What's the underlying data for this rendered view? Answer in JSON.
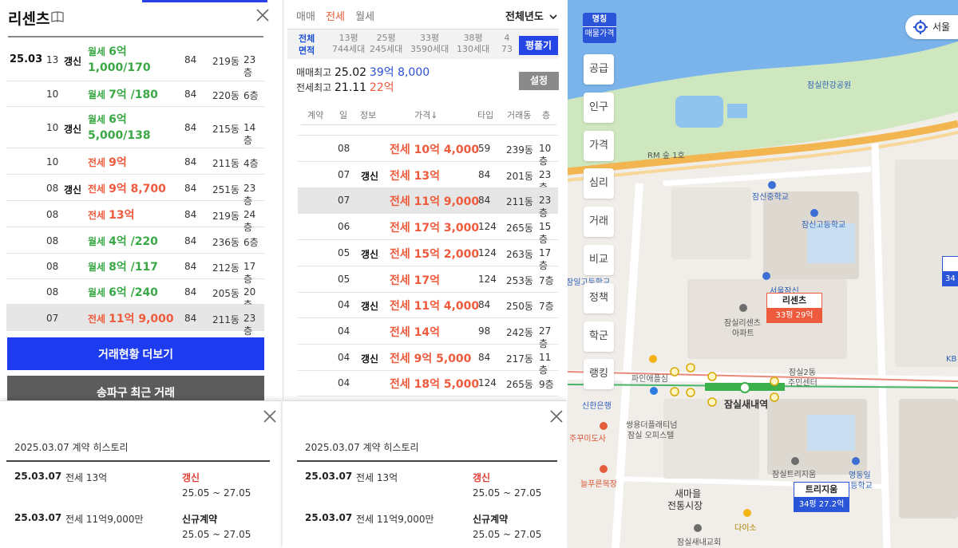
{
  "left": {
    "title": "리센츠",
    "rows": [
      {
        "ym": "25.03",
        "day": "13",
        "renew": "갱신",
        "kind": "월세",
        "price": "6억",
        "price2": "1,000/170",
        "type": "84",
        "dong": "219동",
        "floor": "23층"
      },
      {
        "ym": "",
        "day": "10",
        "renew": "",
        "kind": "월세",
        "price": "7억 /180",
        "price2": "",
        "type": "84",
        "dong": "220동",
        "floor": "6층"
      },
      {
        "ym": "",
        "day": "10",
        "renew": "갱신",
        "kind": "월세",
        "price": "6억",
        "price2": "5,000/138",
        "type": "84",
        "dong": "215동",
        "floor": "14층"
      },
      {
        "ym": "",
        "day": "10",
        "renew": "",
        "kind": "전세",
        "price": "9억",
        "price2": "",
        "type": "84",
        "dong": "211동",
        "floor": "4층"
      },
      {
        "ym": "",
        "day": "08",
        "renew": "갱신",
        "kind": "전세",
        "price": "9억 8,700",
        "price2": "",
        "type": "84",
        "dong": "251동",
        "floor": "23층"
      },
      {
        "ym": "",
        "day": "08",
        "renew": "",
        "kind": "전세",
        "price": "13억",
        "price2": "",
        "type": "84",
        "dong": "219동",
        "floor": "24층"
      },
      {
        "ym": "",
        "day": "08",
        "renew": "",
        "kind": "월세",
        "price": "4억 /220",
        "price2": "",
        "type": "84",
        "dong": "236동",
        "floor": "6층"
      },
      {
        "ym": "",
        "day": "08",
        "renew": "",
        "kind": "월세",
        "price": "8억 /117",
        "price2": "",
        "type": "84",
        "dong": "212동",
        "floor": "17층"
      },
      {
        "ym": "",
        "day": "08",
        "renew": "",
        "kind": "월세",
        "price": "6억 /240",
        "price2": "",
        "type": "84",
        "dong": "205동",
        "floor": "20층"
      },
      {
        "ym": "",
        "day": "07",
        "renew": "",
        "kind": "전세",
        "price": "11억 9,000",
        "price2": "",
        "type": "84",
        "dong": "211동",
        "floor": "23층"
      }
    ],
    "more_button": "거래현황 더보기",
    "songpa_button": "송파구 최근 거래"
  },
  "history": {
    "header": "2025.03.07 계약 히스토리",
    "items": [
      {
        "date": "25.03.07",
        "price": "전세 13억",
        "kind": "갱신",
        "period": "25.05 ~ 27.05"
      },
      {
        "date": "25.03.07",
        "price": "전세 11억9,000만",
        "kind": "신규계약",
        "period": "25.05 ~ 27.05"
      }
    ]
  },
  "mid": {
    "tabs": [
      "매매",
      "전세",
      "월세"
    ],
    "active_tab": "전세",
    "year_select": "전체년도",
    "size_label1": "전체",
    "size_label2": "면적",
    "sizes": [
      {
        "p": "13평",
        "u": "744세대"
      },
      {
        "p": "25평",
        "u": "245세대"
      },
      {
        "p": "33평",
        "u": "3590세대"
      },
      {
        "p": "38평",
        "u": "130세대"
      },
      {
        "p": "4",
        "u": "73"
      }
    ],
    "pyeong_button": "평풀기",
    "max_sale_label": "매매최고",
    "max_sale_date": "25.02",
    "max_sale_price": "39억 8,000",
    "max_jeonse_label": "전세최고",
    "max_jeonse_date": "21.11",
    "max_jeonse_price": "22억",
    "settings_button": "설정",
    "columns": [
      "계약",
      "일",
      "정보",
      "가격↓",
      "타입",
      "거래동",
      "층"
    ],
    "rows": [
      {
        "day": "08",
        "renew": "",
        "price": "전세 10억 4,000",
        "type": "59",
        "dong": "239동",
        "floor": "10층"
      },
      {
        "day": "07",
        "renew": "갱신",
        "price": "전세 13억",
        "type": "84",
        "dong": "201동",
        "floor": "23층"
      },
      {
        "day": "07",
        "renew": "",
        "price": "전세 11억 9,000",
        "type": "84",
        "dong": "211동",
        "floor": "23층"
      },
      {
        "day": "06",
        "renew": "",
        "price": "전세 17억 3,000",
        "type": "124",
        "dong": "265동",
        "floor": "15층"
      },
      {
        "day": "05",
        "renew": "갱신",
        "price": "전세 15억 2,000",
        "type": "124",
        "dong": "263동",
        "floor": "17층"
      },
      {
        "day": "05",
        "renew": "",
        "price": "전세 17억",
        "type": "124",
        "dong": "253동",
        "floor": "7층"
      },
      {
        "day": "04",
        "renew": "갱신",
        "price": "전세 11억 4,000",
        "type": "84",
        "dong": "250동",
        "floor": "7층"
      },
      {
        "day": "04",
        "renew": "",
        "price": "전세 14억",
        "type": "98",
        "dong": "242동",
        "floor": "27층"
      },
      {
        "day": "04",
        "renew": "갱신",
        "price": "전세 9억 5,000",
        "type": "84",
        "dong": "217동",
        "floor": "11층"
      },
      {
        "day": "04",
        "renew": "",
        "price": "전세 18억 5,000",
        "type": "124",
        "dong": "265동",
        "floor": "9층"
      }
    ]
  },
  "map": {
    "name_toggle1": "명칭",
    "name_toggle2": "매물가격",
    "side_buttons": [
      "공급",
      "인구",
      "가격",
      "심리",
      "거래",
      "비교",
      "정책",
      "학군",
      "랭킹"
    ],
    "location_button": "서울",
    "labels": {
      "park": "잠실한강공원",
      "rm": "RM 숲 1호",
      "middle_school": "잠신중학교",
      "high_school": "잠신고등학교",
      "jamil": "잠일고등학교",
      "seoul_jamsin": "서울잠신",
      "ricenz_apt1": "잠실리센츠",
      "ricenz_apt2": "아파트",
      "pine": "파인애플심",
      "shinhan": "신한은행",
      "twinstell1": "쌍용더플래티넘",
      "twinstell2": "잠실 오피스텔",
      "station": "잠실새내역",
      "jamsil2": "잠실2동",
      "center": "주민센터",
      "jupu": "주꾸미도사",
      "neulpu": "늘푸른목장",
      "saemaeul1": "새마을",
      "saemaeul2": "전통시장",
      "daiso": "다이소",
      "trizium": "잠실트리지움",
      "yeongdongil1": "영동일",
      "yeongdongil2": "고등학교",
      "church": "잠실새내교회",
      "kb": "KB"
    },
    "marker1_name": "리센츠",
    "marker1_info": "33평 29억",
    "marker2_name": "트리지움",
    "marker2_info": "34평 27.2억",
    "marker3_info": "34"
  },
  "colors": {
    "blue": "#1d3cf0",
    "wolse": "#3aa845",
    "jeonse": "#ee5a3c",
    "river": "#7ab4ea",
    "marker_red": "#ee5a3c"
  }
}
